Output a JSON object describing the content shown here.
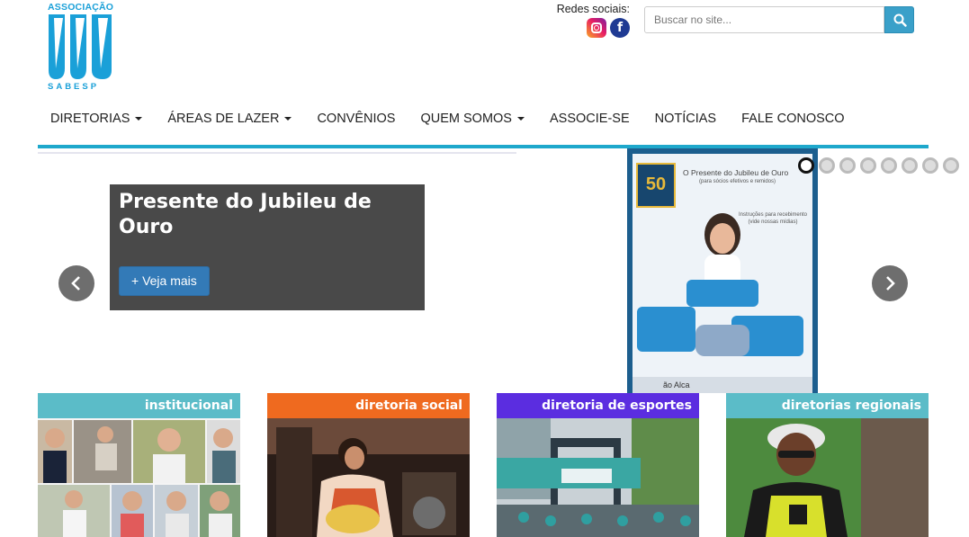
{
  "logo": {
    "top_text": "ASSOCIAÇÃO",
    "bottom_text": "SABESP"
  },
  "social": {
    "label": "Redes sociais:",
    "icons": [
      "instagram-icon",
      "facebook-icon"
    ]
  },
  "search": {
    "placeholder": "Buscar no site..."
  },
  "nav": {
    "items": [
      {
        "label": "DIRETORIAS",
        "dropdown": true
      },
      {
        "label": "ÁREAS DE LAZER",
        "dropdown": true
      },
      {
        "label": "CONVÊNIOS",
        "dropdown": false
      },
      {
        "label": "QUEM SOMOS",
        "dropdown": true
      },
      {
        "label": "ASSOCIE-SE",
        "dropdown": false
      },
      {
        "label": "NOTÍCIAS",
        "dropdown": false
      },
      {
        "label": "FALE CONOSCO",
        "dropdown": false
      }
    ]
  },
  "carousel": {
    "caption_title": "Presente do Jubileu de Ouro",
    "cta_label": "+ Veja mais",
    "slide_count": 8,
    "active_slide": 1,
    "poster": {
      "badge": "50",
      "title": "O Presente do Jubileu de Ouro",
      "subtitle": "(para sócios efetivos e remidos)",
      "instructions": "Instruções para recebimento (vide nossas mídias)",
      "footer": "ão Alca"
    }
  },
  "cards": [
    {
      "label": "institucional",
      "color": "#5bbcc8"
    },
    {
      "label": "diretoria social",
      "color": "#ef6a1f"
    },
    {
      "label": "diretoria de esportes",
      "color": "#5b2de0"
    },
    {
      "label": "diretorias regionais",
      "color": "#5bbcc8"
    }
  ],
  "colors": {
    "accent": "#1ea8cc",
    "button": "#337ab7"
  }
}
